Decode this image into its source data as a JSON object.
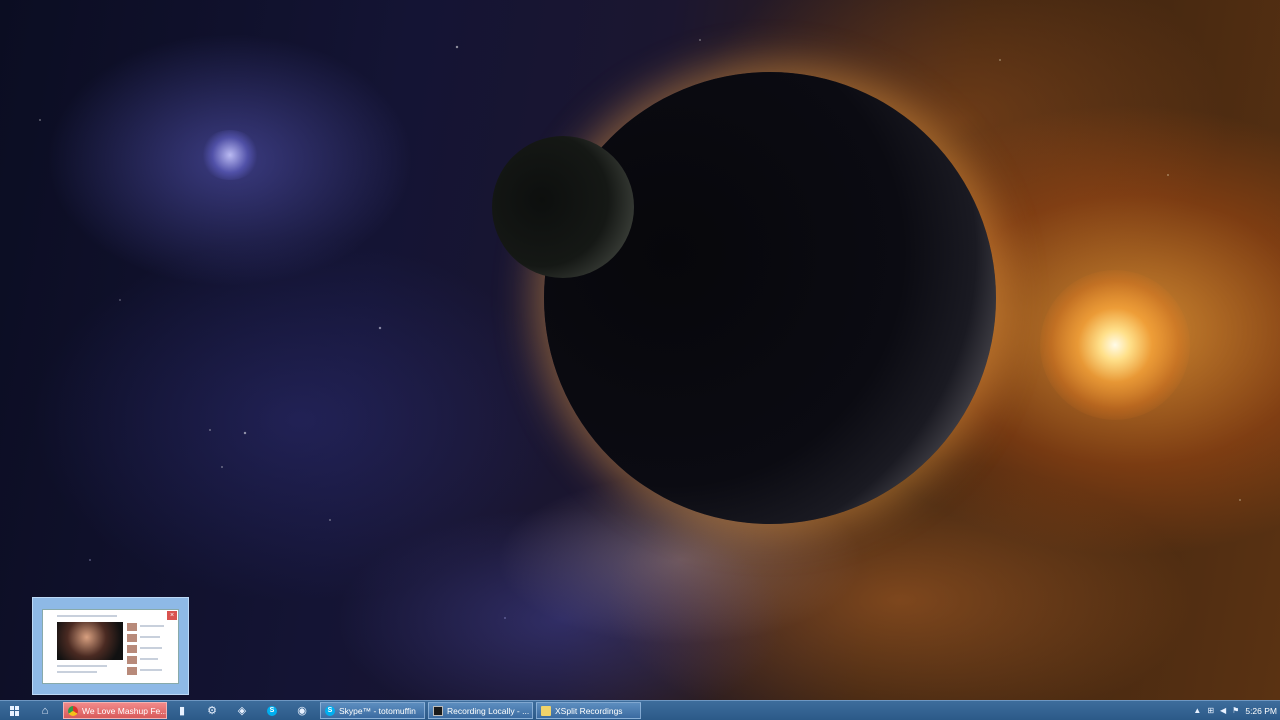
{
  "taskbar": {
    "buttons": [
      {
        "label": "We Love Mashup Fe...",
        "icon": "chrome-icon",
        "active": true
      },
      {
        "label": "Skype™ - totomuffin",
        "icon": "skype-icon"
      },
      {
        "label": "Recording Locally - ...",
        "icon": "cmd-icon"
      },
      {
        "label": "XSplit Recordings",
        "icon": "folder-icon"
      }
    ],
    "pinned_icons": [
      "start-icon",
      "home-icon",
      "launcher-icon",
      "steam-icon",
      "browser-icon",
      "skype-icon",
      "firefox-icon"
    ],
    "clock": "5:26 PM",
    "tray_glyphs": {
      "arrow": "▲",
      "network": "⊞",
      "volume": "◀",
      "flag": "⚑"
    }
  },
  "preview": {
    "close_glyph": "×"
  },
  "colors": {
    "taskbar": "#2c5a88",
    "active_button": "#d85a5a",
    "preview_border": "#96c3f0"
  }
}
